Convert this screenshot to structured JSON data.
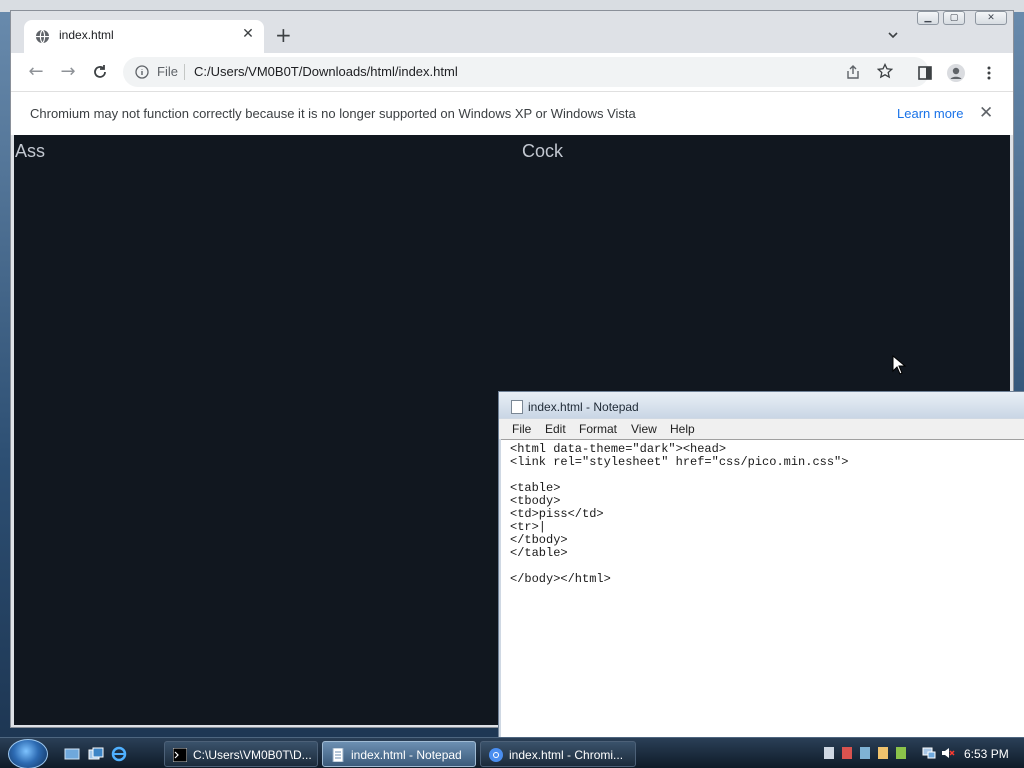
{
  "browser": {
    "tab_title": "index.html",
    "address_scheme": "File",
    "address_url": "C:/Users/VM0B0T/Downloads/html/index.html",
    "infobar_message": "Chromium may not function correctly because it is no longer supported on Windows XP or Windows Vista",
    "infobar_link": "Learn more",
    "page_cells": [
      "Ass",
      "Cock"
    ]
  },
  "notepad": {
    "title": "index.html - Notepad",
    "menu": [
      "File",
      "Edit",
      "Format",
      "View",
      "Help"
    ],
    "content": "<html data-theme=\"dark\"><head>\n<link rel=\"stylesheet\" href=\"css/pico.min.css\">\n\n<table>\n<tbody>\n<td>piss</td>\n<tr>|\n</tbody>\n</table>\n\n</body></html>"
  },
  "taskbar": {
    "tasks": [
      {
        "label": "C:\\Users\\VM0B0T\\D...",
        "icon": "cmd-icon"
      },
      {
        "label": "index.html - Notepad",
        "icon": "notepad-icon"
      },
      {
        "label": "index.html - Chromi...",
        "icon": "chromium-icon"
      }
    ],
    "clock": "6:53 PM"
  },
  "colors": {
    "page_background": "#11171f",
    "link_blue": "#1a73e8"
  }
}
